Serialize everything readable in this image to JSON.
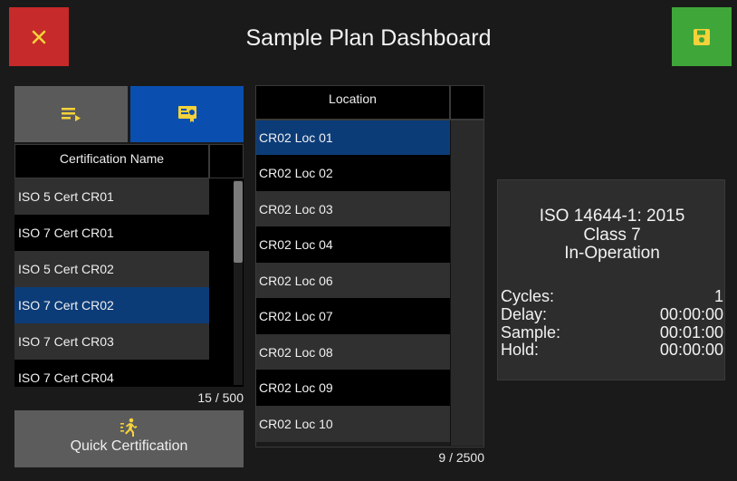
{
  "header": {
    "title": "Sample Plan Dashboard",
    "close_icon": "close-icon",
    "save_icon": "save-icon"
  },
  "colors": {
    "close": "#c62a2a",
    "save": "#3fa63a",
    "accent": "#0a4fb0",
    "selected_row": "#0c3c78"
  },
  "certifications": {
    "column_header": "Certification Name",
    "rows": [
      "ISO 5 Cert CR01",
      "ISO 7 Cert CR01",
      "ISO 5 Cert CR02",
      "ISO 7 Cert CR02",
      "ISO 7 Cert CR03",
      "ISO 7 Cert CR04"
    ],
    "selected_index": 3,
    "count": "15 / 500"
  },
  "quick_certification": {
    "label": "Quick Certification",
    "icon": "running-person-icon"
  },
  "locations": {
    "column_header": "Location",
    "rows": [
      "CR02 Loc 01",
      "CR02 Loc 02",
      "CR02 Loc 03",
      "CR02 Loc 04",
      "CR02 Loc 06",
      "CR02 Loc 07",
      "CR02 Loc 08",
      "CR02 Loc 09",
      "CR02 Loc 10"
    ],
    "selected_index": 0,
    "count": "9 / 2500"
  },
  "info": {
    "standard": "ISO 14644-1: 2015",
    "class": "Class 7",
    "state": "In-Operation",
    "stats": [
      {
        "label": "Cycles:",
        "value": "1"
      },
      {
        "label": "Delay:",
        "value": "00:00:00"
      },
      {
        "label": "Sample:",
        "value": "00:01:00"
      },
      {
        "label": "Hold:",
        "value": "00:00:00"
      }
    ]
  }
}
